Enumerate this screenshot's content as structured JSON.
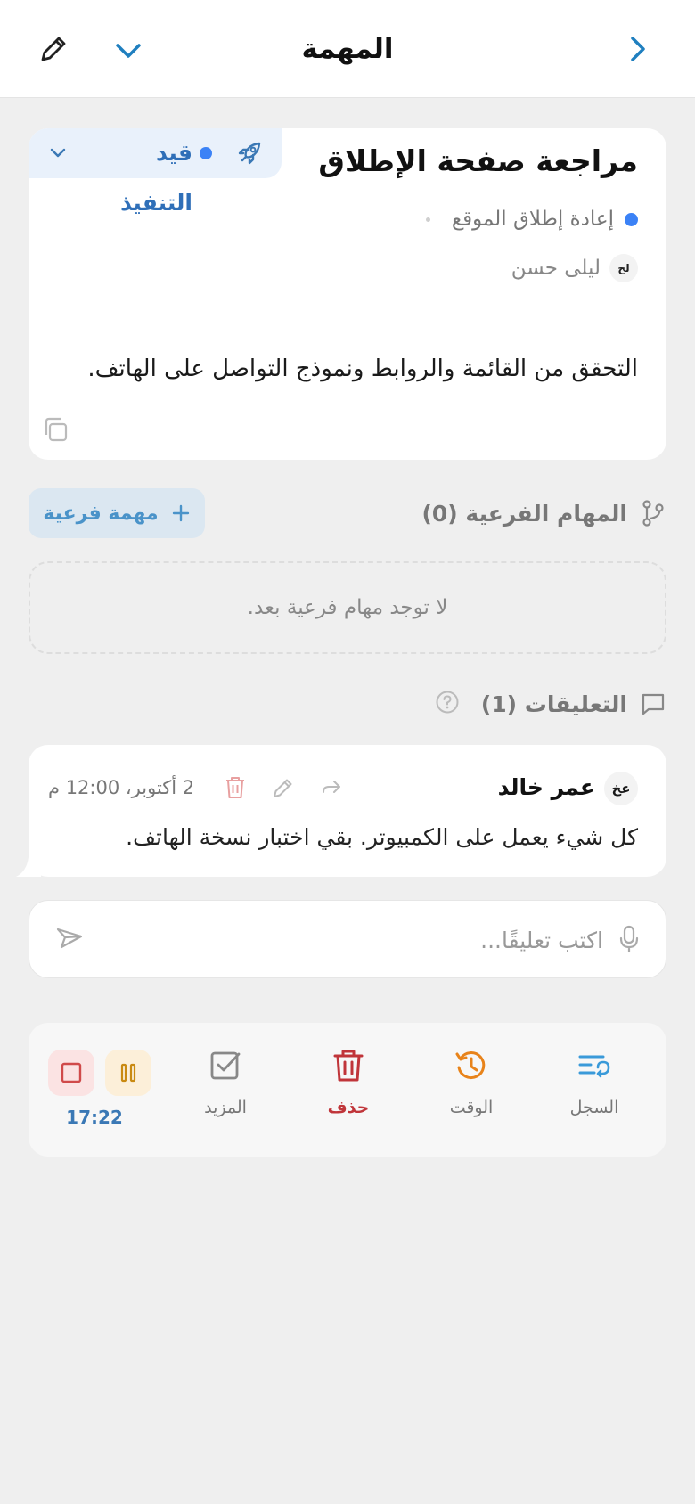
{
  "header": {
    "title": "المهمة"
  },
  "task": {
    "title": "مراجعة صفحة الإطلاق",
    "status": "قيد التنفيذ",
    "project": "إعادة إطلاق الموقع",
    "assignee_initials": "لح",
    "assignee": "ليلى حسن",
    "description": "التحقق من القائمة والروابط ونموذج التواصل على الهاتف."
  },
  "subtasks": {
    "label": "المهام الفرعية (0)",
    "add_label": "مهمة فرعية",
    "empty": "لا توجد مهام فرعية بعد."
  },
  "comments": {
    "label": "التعليقات (1)",
    "items": [
      {
        "initials": "عخ",
        "author": "عمر خالد",
        "time": "2 أكتوبر، 12:00 م",
        "text": "كل شيء يعمل على الكمبيوتر. بقي اختبار نسخة الهاتف."
      }
    ],
    "input_placeholder": "اكتب تعليقًا..."
  },
  "actions": {
    "log": "السجل",
    "time": "الوقت",
    "delete": "حذف",
    "more": "المزيد",
    "timer": "17:22"
  },
  "colors": {
    "accent_blue": "#3b82f6",
    "status_text": "#2f6fb8",
    "delete_red": "#c0353a",
    "time_orange": "#e8831a",
    "pause_amber": "#c98a12",
    "timer_blue": "#3a78b5"
  },
  "icons": {
    "back": "chevron-right-icon",
    "dropdown": "chevron-down-icon",
    "edit": "pencil-icon",
    "status": "rocket-icon",
    "copy": "copy-icon",
    "subtasks": "branch-icon",
    "add": "plus-icon",
    "comments": "chat-icon",
    "help": "help-icon",
    "reply": "reply-icon",
    "trash": "trash-icon",
    "mic": "mic-icon",
    "send": "send-icon",
    "log": "history-list-icon",
    "clock": "clock-history-icon",
    "more": "checkbox-icon",
    "pause": "pause-icon",
    "stop": "stop-icon"
  }
}
